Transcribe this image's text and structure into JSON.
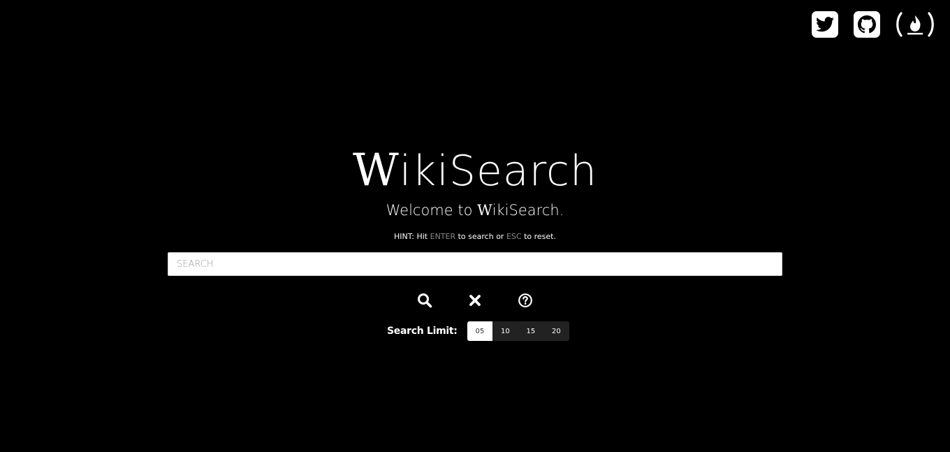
{
  "social": {
    "twitter_icon": "twitter-icon",
    "github_icon": "github-icon",
    "freecodecamp_icon": "freecodecamp-icon"
  },
  "title": {
    "w": "W",
    "rest": "ikiSearch"
  },
  "welcome": {
    "prefix": "Welcome to ",
    "w": "W",
    "rest": "ikiSearch."
  },
  "hint": {
    "prefix": "HINT: Hit ",
    "key1": "ENTER",
    "middle": " to search or ",
    "key2": "ESC",
    "suffix": " to reset."
  },
  "search": {
    "placeholder": "SEARCH",
    "value": ""
  },
  "actions": {
    "search_icon": "search-icon",
    "clear_icon": "close-icon",
    "help_icon": "help-icon"
  },
  "limit": {
    "label": "Search Limit:",
    "options": [
      "05",
      "10",
      "15",
      "20"
    ],
    "selected": "05"
  },
  "colors": {
    "background": "#000000",
    "text": "#ffffff",
    "hint_key": "#8a8a8a",
    "limit_bg": "#222222"
  }
}
